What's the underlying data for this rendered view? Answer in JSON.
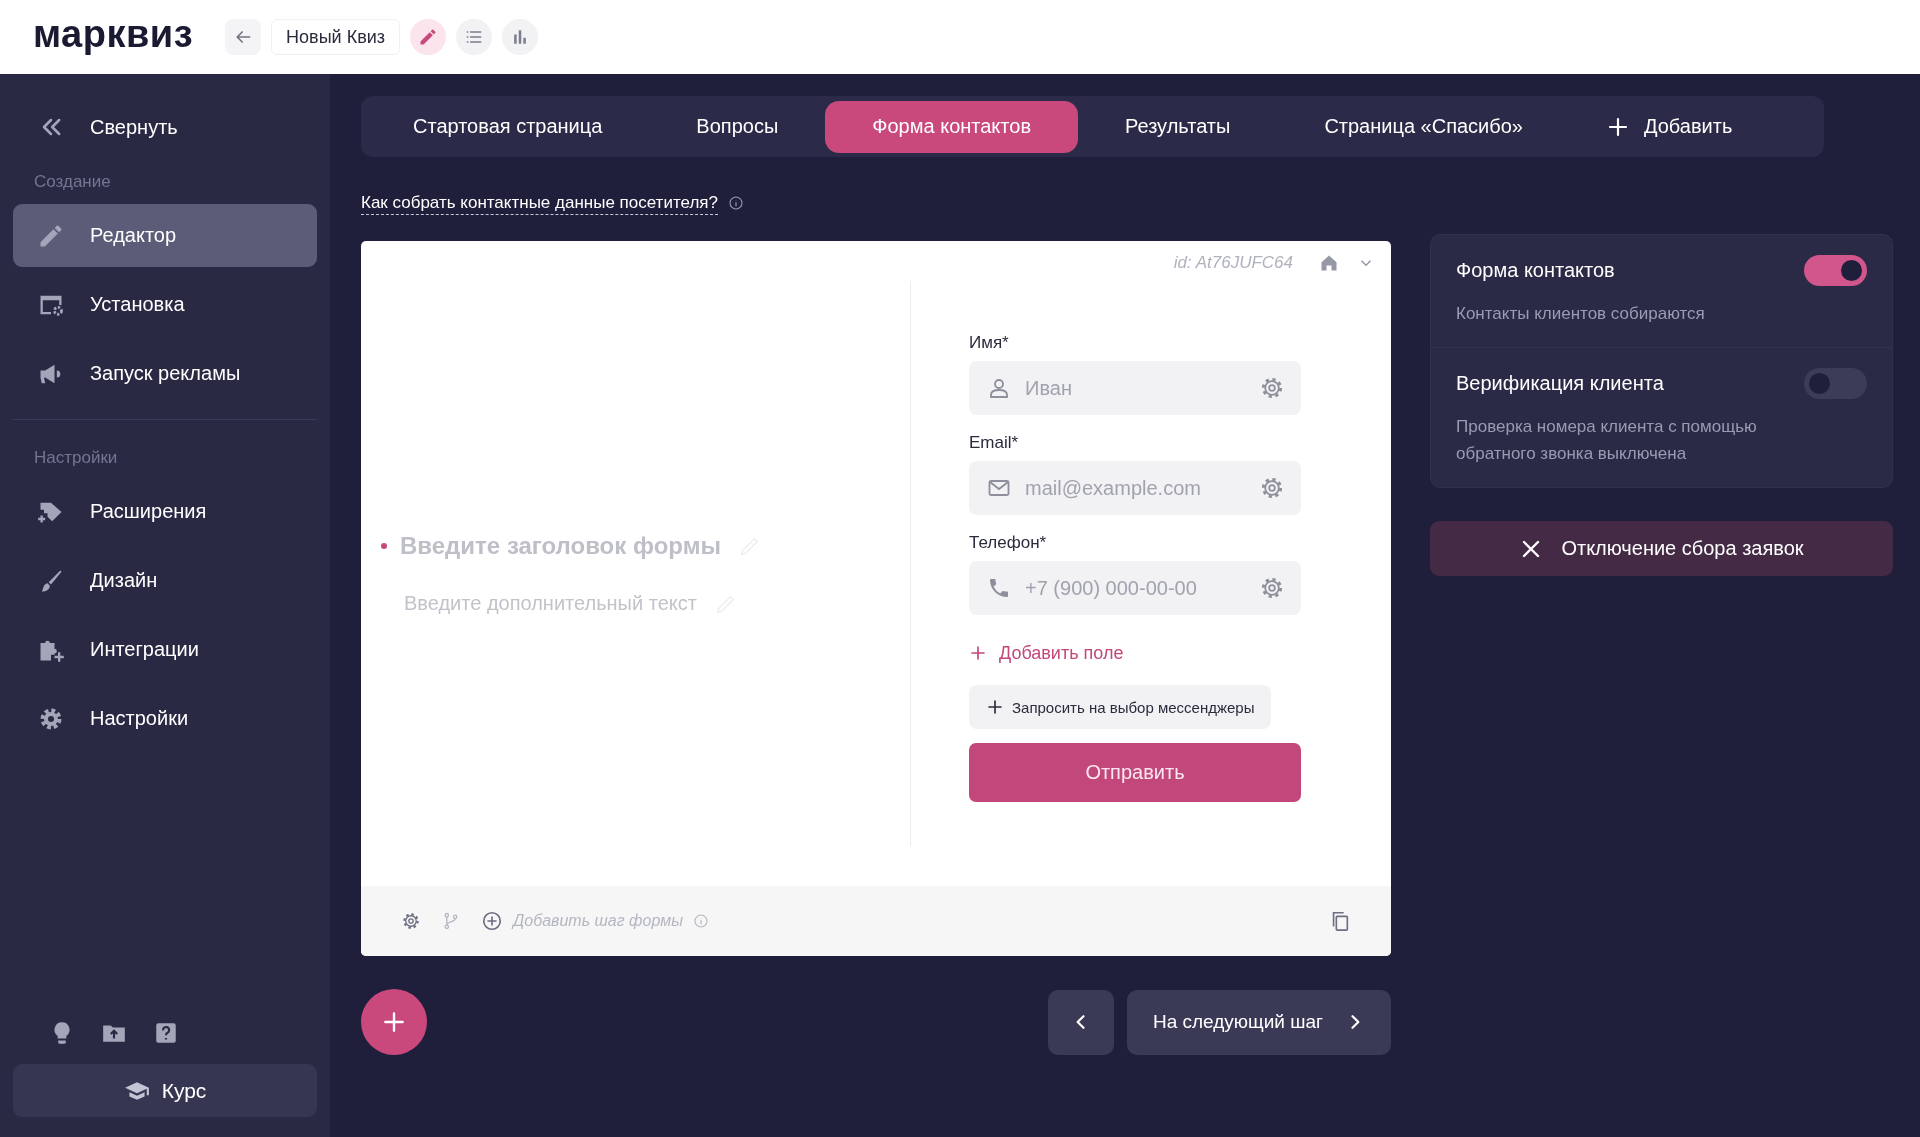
{
  "header": {
    "logo": "марквиз",
    "quiz_title": "Новый Квиз",
    "tools": [
      {
        "kind": "edit",
        "selected": true
      },
      {
        "kind": "list",
        "selected": false
      },
      {
        "kind": "stats",
        "selected": false
      }
    ]
  },
  "sidebar": {
    "collapse": "Свернуть",
    "sections": [
      {
        "title": "Создание",
        "items": [
          {
            "kind": "pencil",
            "label": "Редактор",
            "selected": true
          },
          {
            "kind": "install",
            "label": "Установка",
            "selected": false
          },
          {
            "kind": "megaphone",
            "label": "Запуск рекламы",
            "selected": false
          }
        ]
      },
      {
        "title": "Настройки",
        "items": [
          {
            "kind": "tag",
            "label": "Расширения",
            "selected": false
          },
          {
            "kind": "brush",
            "label": "Дизайн",
            "selected": false
          },
          {
            "kind": "puzzle",
            "label": "Интеграции",
            "selected": false
          },
          {
            "kind": "gear",
            "label": "Настройки",
            "selected": false
          }
        ]
      }
    ],
    "bottom_icons": [
      {
        "kind": "bulb"
      },
      {
        "kind": "folder"
      },
      {
        "kind": "help"
      }
    ],
    "course_button": "Курс"
  },
  "tabs": [
    {
      "label": "Стартовая страница",
      "selected": false
    },
    {
      "label": "Вопросы",
      "selected": false
    },
    {
      "label": "Форма контактов",
      "selected": true
    },
    {
      "label": "Результаты",
      "selected": false
    },
    {
      "label": "Страница «Спасибо»",
      "selected": false
    }
  ],
  "add_tab": "Добавить",
  "help_link": "Как собрать контактные данные посетителя?",
  "form": {
    "id": "id: At76JUFC64",
    "title_placeholder": "Введите заголовок формы",
    "subtitle_placeholder": "Введите дополнительный текст",
    "fields": [
      {
        "label": "Имя*",
        "placeholder": "Иван",
        "kind": "person"
      },
      {
        "label": "Email*",
        "placeholder": "mail@example.com",
        "kind": "mail"
      },
      {
        "label": "Телефон*",
        "placeholder": "+7 (900) 000-00-00",
        "kind": "phone"
      }
    ],
    "add_field": "Добавить поле",
    "messengers_button": "Запросить на выбор мессенджеры",
    "submit": "Отправить",
    "add_step": "Добавить шаг формы"
  },
  "next_button": "На следующий шаг",
  "settings": {
    "toggles": [
      {
        "title": "Форма контактов",
        "description": "Контакты клиентов собираются",
        "on": true
      },
      {
        "title": "Верификация клиента",
        "description": "Проверка номера клиента с помощью обратного звонка выключена",
        "on": false
      }
    ],
    "disable_button": "Отключение сбора заявок"
  }
}
